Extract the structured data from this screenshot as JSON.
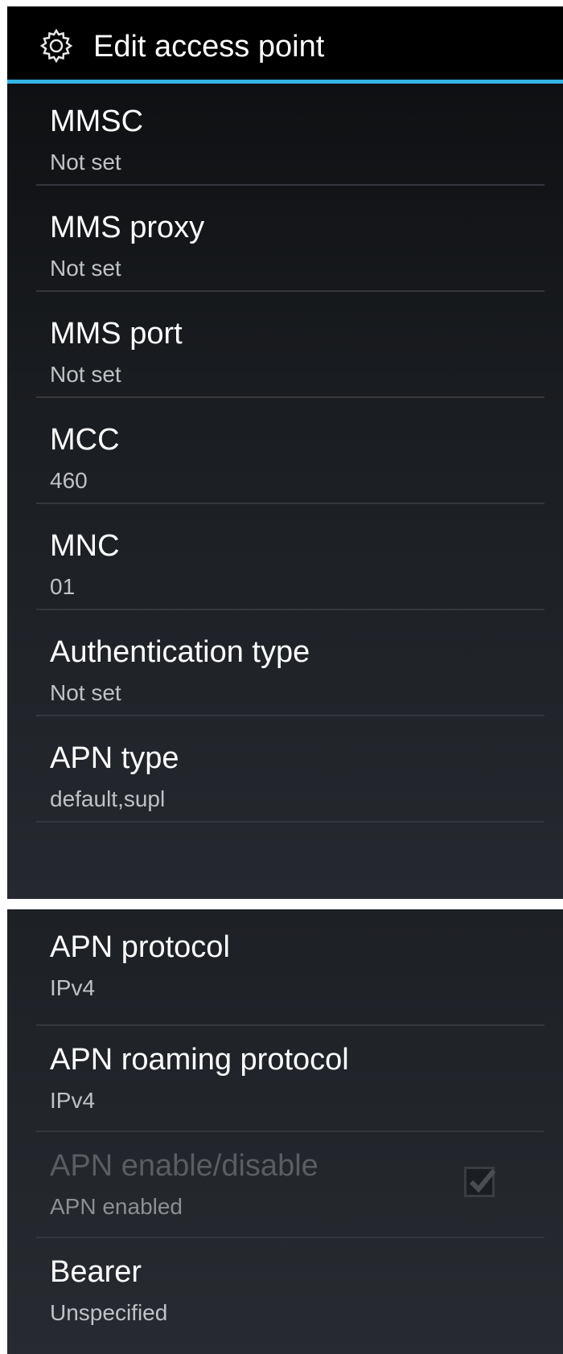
{
  "actionbar": {
    "title": "Edit access point",
    "icon": "gear-icon",
    "accent_color": "#33b5e5"
  },
  "screen1_items": [
    {
      "label": "MMSC",
      "value": "Not set"
    },
    {
      "label": "MMS proxy",
      "value": "Not set"
    },
    {
      "label": "MMS port",
      "value": "Not set"
    },
    {
      "label": "MCC",
      "value": "460"
    },
    {
      "label": "MNC",
      "value": "01"
    },
    {
      "label": "Authentication type",
      "value": "Not set"
    },
    {
      "label": "APN type",
      "value": "default,supl"
    }
  ],
  "screen2_items": [
    {
      "label": "APN protocol",
      "value": "IPv4"
    },
    {
      "label": "APN roaming protocol",
      "value": "IPv4"
    },
    {
      "label": "APN enable/disable",
      "value": "APN enabled",
      "checked": true,
      "enabled": false
    },
    {
      "label": "Bearer",
      "value": "Unspecified"
    }
  ]
}
